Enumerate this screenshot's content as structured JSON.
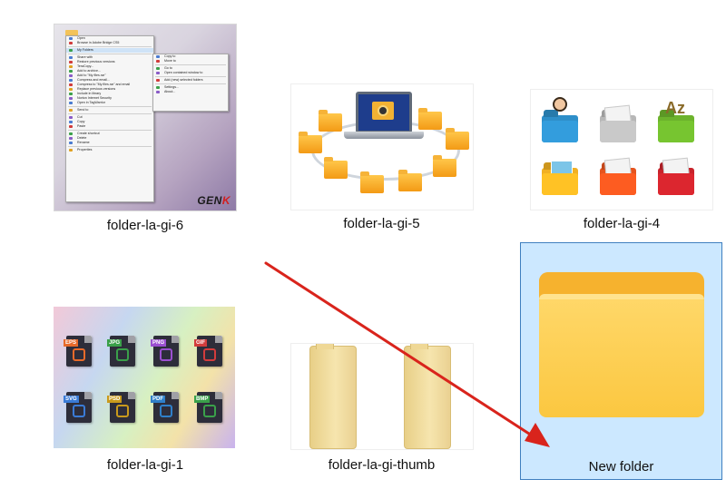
{
  "items": [
    {
      "label": "folder-la-gi-6"
    },
    {
      "label": "folder-la-gi-5"
    },
    {
      "label": "folder-la-gi-4"
    },
    {
      "label": "folder-la-gi-1"
    },
    {
      "label": "folder-la-gi-thumb"
    },
    {
      "label": "New folder",
      "selected": true
    }
  ],
  "context_menu": {
    "items": [
      "Open",
      "Browse in Adobe Bridge CS5",
      "",
      "My Folders",
      "",
      "Share with",
      "Restore previous versions",
      "TeraCopy...",
      "Add to archive...",
      "Add to \"My files.rar\"",
      "Compress and email...",
      "Compress to \"My files.rar\" and email",
      "Replace previous versions",
      "Include in library",
      "Norton Internet Security",
      "Open in TagWarrior",
      "",
      "Send to",
      "",
      "Cut",
      "Copy",
      "Paste",
      "",
      "Create shortcut",
      "Delete",
      "Rename",
      "",
      "Properties"
    ],
    "submenu": [
      "Copy to",
      "Move to",
      "",
      "Go to",
      "Open contained window to",
      "",
      "Add (new) selected folders",
      "",
      "Settings...",
      "About..."
    ]
  },
  "watermark": {
    "text_a": "GEN",
    "text_b": "K"
  },
  "file_types": [
    "EPS",
    "JPG",
    "PNG",
    "GIF",
    "SVG",
    "PSD",
    "PDF",
    "BMP"
  ],
  "colors": {
    "selection_fill": "#cce8ff",
    "selection_border": "#3f7fbf",
    "arrow": "#d9241c"
  },
  "arrow_icon": "red-arrow-pointer"
}
